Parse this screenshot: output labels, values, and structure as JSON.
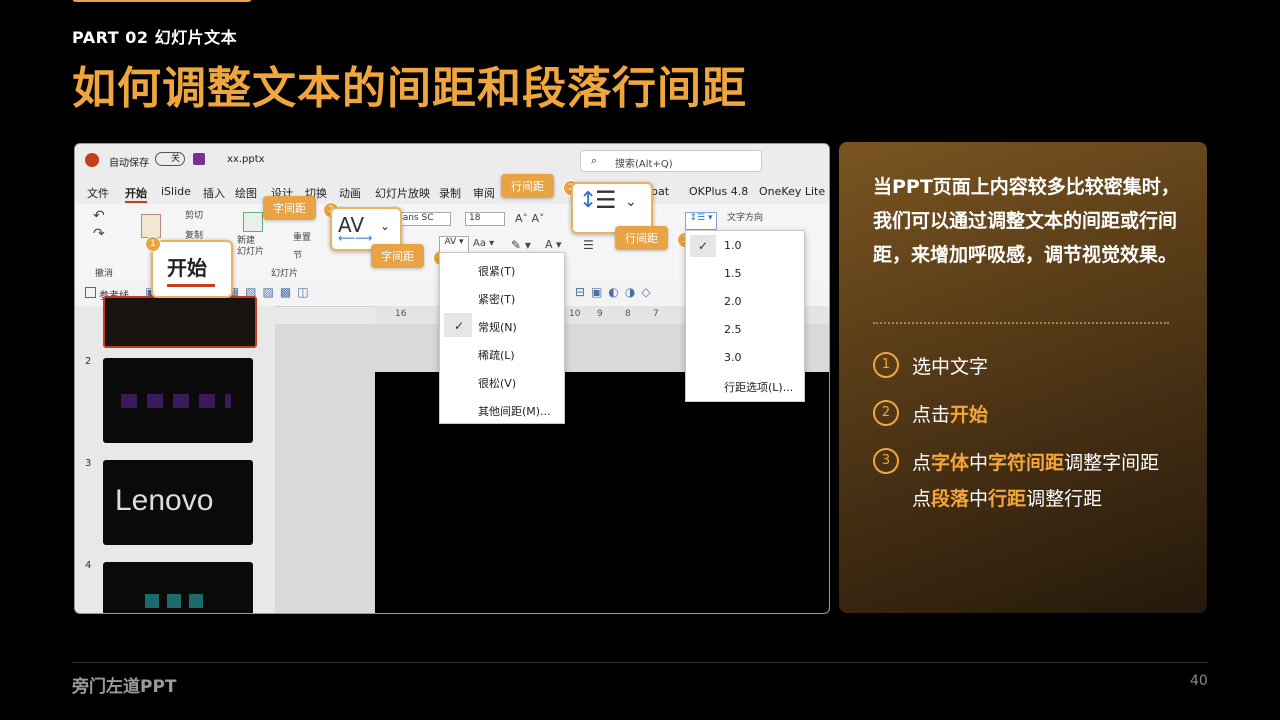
{
  "header": {
    "part": "PART 02  幻灯片文本",
    "title": "如何调整文本的间距和段落行间距"
  },
  "screenshot": {
    "autosave_label": "自动保存",
    "autosave_state": "关",
    "filename": "xx.pptx",
    "search_placeholder": "搜索(Alt+Q)",
    "menu_items": [
      "文件",
      "开始",
      "iSlide",
      "插入",
      "绘图",
      "设计",
      "切换",
      "动画",
      "幻灯片放映",
      "录制",
      "审阅",
      "bat",
      "OKPlus 4.8",
      "OneKey Lite"
    ],
    "ribbon": {
      "cut": "剪切",
      "copy": "复制",
      "paste_group": "撤消",
      "new_slide": "新建\n幻灯片",
      "reset": "重置",
      "section": "节",
      "slides_group": "幻灯片",
      "font": "Sans SC",
      "font_size": "18",
      "text_direction": "文字方向"
    },
    "quick_access": "参考线",
    "ruler_labels": [
      "16",
      "15",
      "10",
      "9",
      "8",
      "7"
    ],
    "home_callout": "开始",
    "tags": {
      "char_spacing_1": "字间距",
      "char_spacing_2": "字间距",
      "line_spacing_1": "行间距",
      "line_spacing_2": "行间距"
    },
    "badges": [
      "1",
      "2",
      "3",
      "2",
      "3"
    ],
    "char_spacing_menu": [
      "很紧(T)",
      "紧密(T)",
      "常规(N)",
      "稀疏(L)",
      "很松(V)",
      "其他间距(M)..."
    ],
    "char_spacing_checked": "常规(N)",
    "line_spacing_menu": [
      "1.0",
      "1.5",
      "2.0",
      "2.5",
      "3.0",
      "行距选项(L)..."
    ],
    "line_spacing_checked": "1.0",
    "thumb_numbers": [
      "2",
      "3",
      "4"
    ],
    "thumb_logo": "Lenovo"
  },
  "panel": {
    "description": "当PPT页面上内容较多比较密集时，我们可以通过调整文本的间距或行间距，来增加呼吸感，调节视觉效果。",
    "steps": [
      {
        "num": "1",
        "parts": [
          "选中文字"
        ]
      },
      {
        "num": "2",
        "parts": [
          "点击",
          "开始"
        ]
      },
      {
        "num": "3",
        "parts": [
          "点",
          "字体",
          "中",
          "字符间距",
          "调整字间距"
        ]
      }
    ],
    "step3_line2": [
      "点",
      "段落",
      "中",
      "行距",
      "调整行距"
    ]
  },
  "footer": {
    "brand": "旁门左道PPT",
    "page": "40"
  },
  "colors": {
    "accent": "#f0a63e",
    "background": "#000000",
    "panel_top": "#7a5520",
    "panel_bottom": "#24180b"
  }
}
